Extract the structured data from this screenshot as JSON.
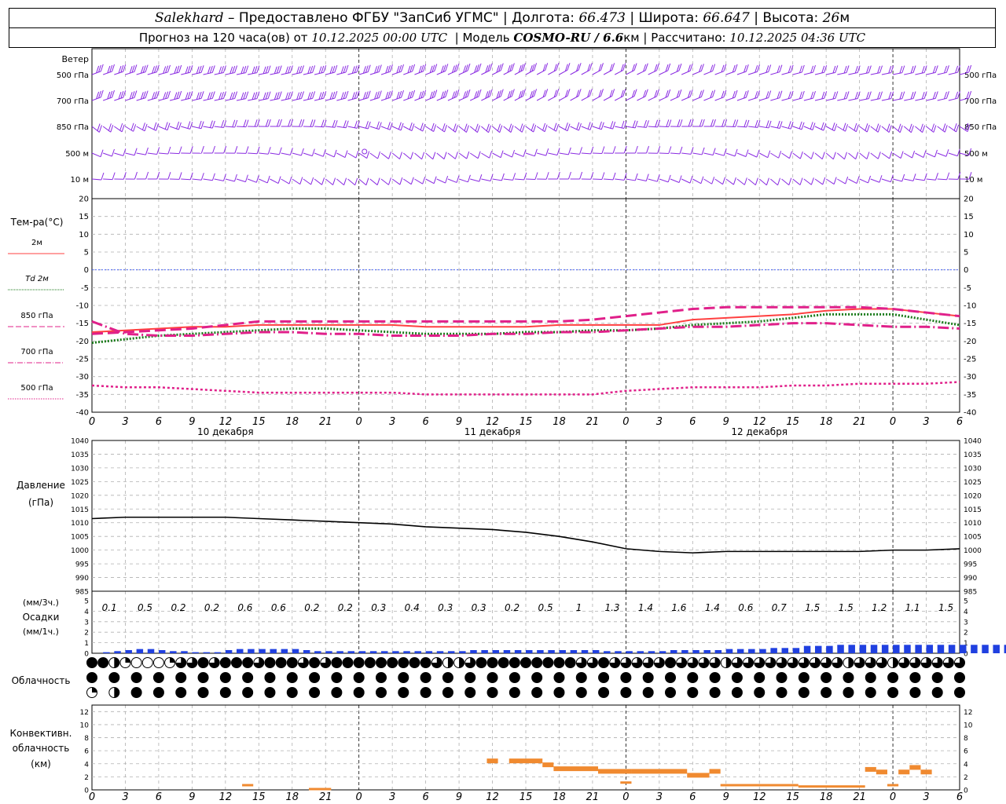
{
  "header": {
    "station": "Salekhard",
    "provider": "Предоставлено ФГБУ \"ЗапСиб УГМС\"",
    "lon_label": "Долгота:",
    "lon": "66.473",
    "lat_label": "Широта:",
    "lat": "66.647",
    "alt_label": "Высота:",
    "alt": "26",
    "alt_unit": "м",
    "forecast_prefix": "Прогноз на 120 часа(ов) от",
    "forecast_time": "10.12.2025 00:00 UTC",
    "model_label": "Модель",
    "model": "COSMO-RU / 6.6",
    "model_unit": "км",
    "calc_label": "Рассчитано:",
    "calc_time": "10.12.2025 04:36 UTC"
  },
  "x_axis": {
    "hour_ticks": [
      "0",
      "3",
      "6",
      "9",
      "12",
      "15",
      "18",
      "21",
      "0",
      "3",
      "6",
      "9",
      "12",
      "15",
      "18",
      "21",
      "0",
      "3",
      "6",
      "9",
      "12",
      "15",
      "18",
      "21",
      "0",
      "3",
      "6"
    ],
    "dates": [
      "10 декабря",
      "11 декабря",
      "12 декабря"
    ]
  },
  "wind_panel": {
    "title": "Ветер",
    "levels": [
      "500 гПа",
      "700 гПа",
      "850 гПа",
      "500 м",
      "10 м"
    ],
    "color": "#8a2be2"
  },
  "labels": {
    "temp_title": "Тем-ра(°C)",
    "pressure_title": "Давление",
    "pressure_unit": "(гПа)",
    "precip_unit3": "(мм/3ч.)",
    "precip_title": "Осадки",
    "precip_unit1": "(мм/1ч.)",
    "cloud_title": "Облачность",
    "conv_title1": "Конвективн.",
    "conv_title2": "облачность",
    "conv_unit": "(км)"
  },
  "chart_data": [
    {
      "type": "line",
      "title": "Тем-ра(°C)",
      "ylim": [
        -40,
        20
      ],
      "y_ticks": [
        "20",
        "15",
        "10",
        "5",
        "0",
        "-5",
        "-10",
        "-15",
        "-20",
        "-25",
        "-30",
        "-35",
        "-40"
      ],
      "x_hours": [
        0,
        3,
        6,
        9,
        12,
        15,
        18,
        21,
        24,
        27,
        30,
        33,
        36,
        39,
        42,
        45,
        48,
        51,
        54,
        57,
        60,
        63,
        66,
        69,
        72,
        75,
        78
      ],
      "series": [
        {
          "name": "2м",
          "color": "#ff4040",
          "dash": "",
          "width": 2,
          "values": [
            -17.5,
            -17,
            -16.5,
            -16,
            -16,
            -15.5,
            -15.5,
            -15.5,
            -15.5,
            -15.5,
            -16,
            -16,
            -16,
            -16,
            -15.5,
            -15.5,
            -15.5,
            -15.5,
            -14,
            -13.5,
            -13,
            -12.5,
            -11.5,
            -11,
            -11,
            -12,
            -13
          ]
        },
        {
          "name": "Td 2м",
          "color": "#1a7a1a",
          "dash": "2,2",
          "width": 3,
          "values": [
            -20.5,
            -19.5,
            -18.5,
            -18,
            -17.5,
            -17,
            -16.5,
            -16.5,
            -17,
            -17.5,
            -18,
            -18,
            -18,
            -17.5,
            -17.5,
            -17,
            -17,
            -16.5,
            -15.5,
            -15,
            -14.5,
            -13.5,
            -12.5,
            -12.5,
            -12.5,
            -14,
            -15.5
          ]
        },
        {
          "name": "850 гПа",
          "color": "#e0208a",
          "dash": "14,6",
          "width": 3,
          "values": [
            -18,
            -17.5,
            -17,
            -16.5,
            -15.5,
            -14.5,
            -14.5,
            -14.5,
            -14.5,
            -14.5,
            -14.5,
            -14.5,
            -14.5,
            -14.5,
            -14.5,
            -14,
            -13,
            -12,
            -11,
            -10.5,
            -10.5,
            -10.5,
            -10.5,
            -10.5,
            -11,
            -12,
            -13
          ]
        },
        {
          "name": "700 гПа",
          "color": "#e0208a",
          "dash": "14,4,2,4",
          "width": 3,
          "values": [
            -14.5,
            -18,
            -18.5,
            -18.5,
            -18,
            -17.5,
            -17.5,
            -18,
            -18,
            -18.5,
            -18.5,
            -18.5,
            -18,
            -18,
            -17.5,
            -17.5,
            -17,
            -16.5,
            -16,
            -16,
            -15.5,
            -15,
            -15,
            -15.5,
            -16,
            -16,
            -16.5
          ]
        },
        {
          "name": "500 гПа",
          "color": "#e0208a",
          "dash": "3,3",
          "width": 2.5,
          "values": [
            -32.5,
            -33,
            -33,
            -33.5,
            -34,
            -34.5,
            -34.5,
            -34.5,
            -34.5,
            -34.5,
            -35,
            -35,
            -35,
            -35,
            -35,
            -35,
            -34,
            -33.5,
            -33,
            -33,
            -33,
            -32.5,
            -32.5,
            -32,
            -32,
            -32,
            -31.5
          ]
        }
      ]
    },
    {
      "type": "line",
      "title": "Давление",
      "ylabel": "(гПа)",
      "ylim": [
        985,
        1040
      ],
      "y_ticks": [
        "1040",
        "1035",
        "1030",
        "1025",
        "1020",
        "1015",
        "1010",
        "1005",
        "1000",
        "995",
        "990",
        "985"
      ],
      "x_hours": [
        0,
        3,
        6,
        9,
        12,
        15,
        18,
        21,
        24,
        27,
        30,
        33,
        36,
        39,
        42,
        45,
        48,
        51,
        54,
        57,
        60,
        63,
        66,
        69,
        72,
        75,
        78
      ],
      "series": [
        {
          "name": "",
          "color": "#000000",
          "values": [
            1011.5,
            1012,
            1012,
            1012,
            1012,
            1011.5,
            1011,
            1010.5,
            1010,
            1009.5,
            1008.5,
            1008,
            1007.5,
            1006.5,
            1005,
            1003,
            1000.5,
            999.5,
            999,
            999.5,
            999.5,
            999.5,
            999.5,
            999.5,
            1000,
            1000,
            1000.5
          ]
        }
      ]
    },
    {
      "type": "bar",
      "title": "Осадки",
      "ylabel": "(мм/3ч.) (мм/1ч.)",
      "ylim": [
        0,
        5
      ],
      "y_ticks": [
        "5",
        "4",
        "3",
        "2",
        "1",
        "0"
      ],
      "precip_3h_labels": [
        "0.1",
        "0.5",
        "0.2",
        "0.2",
        "0.6",
        "0.6",
        "0.2",
        "0.2",
        "0.3",
        "0.4",
        "0.3",
        "0.3",
        "0.2",
        "0.5",
        "1",
        "1.3",
        "1.4",
        "1.6",
        "1.4",
        "0.6",
        "0.7",
        "1.5",
        "1.5",
        "1.2",
        "1.1",
        "1.5"
      ],
      "hourly_values": [
        0,
        0.1,
        0.2,
        0.3,
        0.4,
        0.4,
        0.3,
        0.2,
        0.2,
        0.1,
        0.1,
        0.1,
        0.3,
        0.4,
        0.4,
        0.4,
        0.4,
        0.4,
        0.4,
        0.3,
        0.2,
        0.2,
        0.2,
        0.2,
        0.2,
        0.2,
        0.2,
        0.2,
        0.2,
        0.2,
        0.2,
        0.2,
        0.2,
        0.2,
        0.3,
        0.3,
        0.3,
        0.3,
        0.3,
        0.3,
        0.3,
        0.3,
        0.3,
        0.3,
        0.3,
        0.3,
        0.2,
        0.2,
        0.2,
        0.2,
        0.2,
        0.2,
        0.3,
        0.3,
        0.3,
        0.3,
        0.3,
        0.4,
        0.4,
        0.4,
        0.4,
        0.5,
        0.5,
        0.5,
        0.7,
        0.7,
        0.7,
        0.8,
        0.8,
        0.8,
        0.8,
        0.8,
        0.8,
        0.8,
        0.8,
        0.8,
        0.8,
        0.8,
        0.8,
        0.8,
        0.8,
        0.8,
        0.8,
        0.8,
        0.8,
        0.8,
        0.8,
        0.7,
        0.7,
        0.6,
        0.5,
        0.5,
        0.5,
        0.5,
        0.5,
        0.5,
        0.5,
        0.5,
        0.5,
        0.6,
        0.7,
        0.8,
        0.8,
        0.9,
        1.0,
        0.9,
        0.9,
        1.0,
        1.0,
        1.0,
        0.9,
        0.9,
        0.8,
        0.8,
        0.8,
        0.7,
        0.7,
        0.7,
        0.6,
        0.6,
        0.6,
        0.7,
        0.8,
        0.8,
        0.9,
        0.9,
        0.9,
        0.9,
        0.9,
        0.9
      ],
      "color": "#2040e0"
    },
    {
      "type": "table",
      "title": "Облачность",
      "rows": 3,
      "columns": 40,
      "cover_fraction": [
        [
          1,
          1,
          0.5,
          0.25,
          0,
          0,
          0,
          0.25,
          0.75,
          0.75,
          1,
          0.75,
          1,
          1,
          1,
          0.75,
          1,
          1,
          1,
          0.75,
          1,
          0.75,
          1,
          1,
          1,
          1,
          1,
          1,
          1,
          1,
          1,
          0.75,
          0.5,
          0.5,
          0.75,
          1,
          1,
          1,
          1,
          1,
          1,
          1,
          1,
          1,
          0.75,
          0.75,
          1,
          0.75,
          0.75,
          0.75,
          0.75,
          0.75,
          1,
          0.75,
          0.75,
          0.75,
          0.75,
          0.5,
          0.75,
          0.75,
          0.75,
          0.75,
          0.75,
          0.75,
          0.75,
          0.75,
          0.75,
          0.75,
          0.5,
          0.75,
          0.75,
          0.75,
          0.5,
          0.75,
          0.75,
          0.75,
          0.75,
          0.75,
          0.75,
          0.75
        ],
        [
          1,
          1,
          1,
          1,
          1,
          1,
          1,
          1,
          1,
          1,
          1,
          1,
          1,
          1,
          1,
          1,
          1,
          1,
          1,
          1,
          1,
          1,
          1,
          1,
          1,
          1,
          1,
          1,
          1,
          1,
          1,
          1,
          1,
          1,
          1,
          1,
          1,
          1,
          1,
          1
        ],
        [
          0.25,
          0.5,
          1,
          1,
          1,
          1,
          1,
          1,
          1,
          1,
          1,
          1,
          1,
          1,
          1,
          1,
          1,
          1,
          1,
          1,
          1,
          1,
          1,
          1,
          1,
          1,
          1,
          1,
          1,
          1,
          1,
          1,
          1,
          1,
          1,
          1,
          1,
          1,
          1,
          1
        ]
      ]
    },
    {
      "type": "bar",
      "title": "Конвективн. облачность",
      "ylabel": "(км)",
      "ylim": [
        0,
        13
      ],
      "y_ticks": [
        "12",
        "10",
        "8",
        "6",
        "4",
        "2",
        "0"
      ],
      "color": "#f08a30",
      "segments": [
        {
          "h0": 13.5,
          "h1": 14.5,
          "top": 0.9
        },
        {
          "h0": 19.5,
          "h1": 21.5,
          "top": 0.3
        },
        {
          "h0": 35.5,
          "h1": 36.5,
          "top": 4.8
        },
        {
          "h0": 37.5,
          "h1": 40.5,
          "top": 4.8
        },
        {
          "h0": 40.5,
          "h1": 41.5,
          "top": 4.2
        },
        {
          "h0": 41.5,
          "h1": 45.5,
          "top": 3.6
        },
        {
          "h0": 45.5,
          "h1": 48.5,
          "top": 3.2
        },
        {
          "h0": 47.5,
          "h1": 48.5,
          "top": 1.3
        },
        {
          "h0": 48.5,
          "h1": 53.5,
          "top": 3.2
        },
        {
          "h0": 53.5,
          "h1": 55.5,
          "top": 2.6
        },
        {
          "h0": 55.5,
          "h1": 56.5,
          "top": 3.2
        },
        {
          "h0": 56.5,
          "h1": 63.5,
          "top": 0.9
        },
        {
          "h0": 63.5,
          "h1": 69.5,
          "top": 0.7
        },
        {
          "h0": 69.5,
          "h1": 70.5,
          "top": 3.5
        },
        {
          "h0": 70.5,
          "h1": 71.5,
          "top": 3.1
        },
        {
          "h0": 71.5,
          "h1": 72.5,
          "top": 0.9
        },
        {
          "h0": 72.5,
          "h1": 73.5,
          "top": 3.1
        },
        {
          "h0": 73.5,
          "h1": 74.5,
          "top": 3.8
        },
        {
          "h0": 74.5,
          "h1": 75.5,
          "top": 3.1
        }
      ]
    }
  ]
}
